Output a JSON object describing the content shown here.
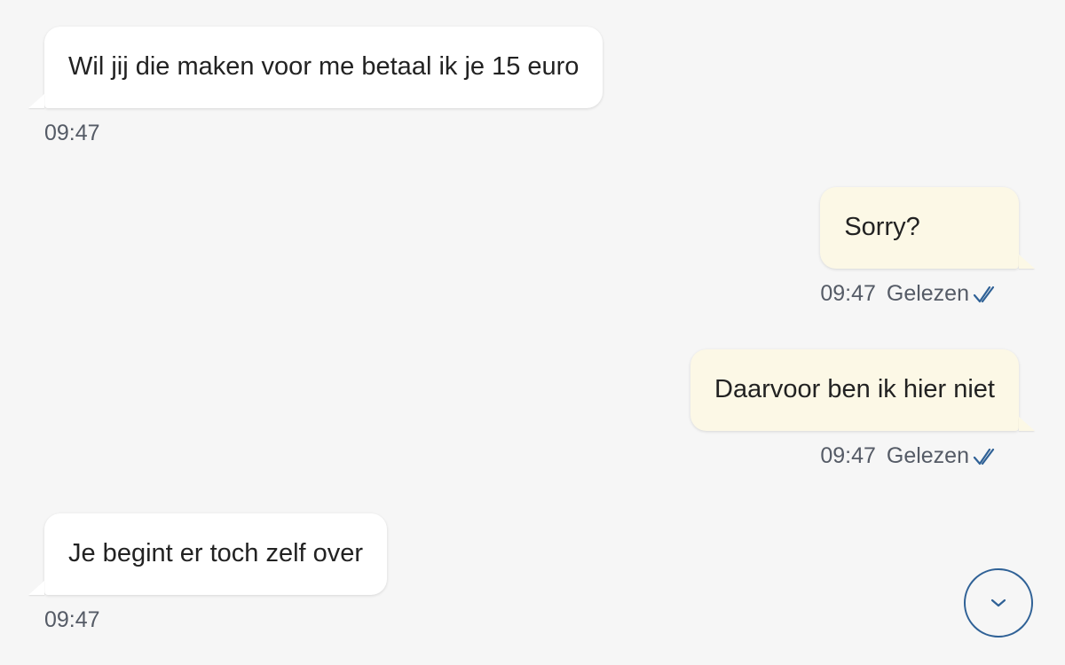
{
  "messages": [
    {
      "direction": "incoming",
      "text": "Wil jij die maken voor me betaal ik je 15 euro",
      "time": "09:47"
    },
    {
      "direction": "outgoing",
      "text": "Sorry?",
      "time": "09:47",
      "status": "Gelezen"
    },
    {
      "direction": "outgoing",
      "text": "Daarvoor ben ik hier niet",
      "time": "09:47",
      "status": "Gelezen"
    },
    {
      "direction": "incoming",
      "text": "Je begint er toch zelf over",
      "time": "09:47"
    }
  ],
  "icons": {
    "read_receipt": "double-check-icon",
    "scroll_down": "chevron-down-icon"
  },
  "colors": {
    "background": "#f6f6f6",
    "incoming_bubble": "#ffffff",
    "outgoing_bubble": "#fcf8e6",
    "accent": "#2f6196"
  }
}
